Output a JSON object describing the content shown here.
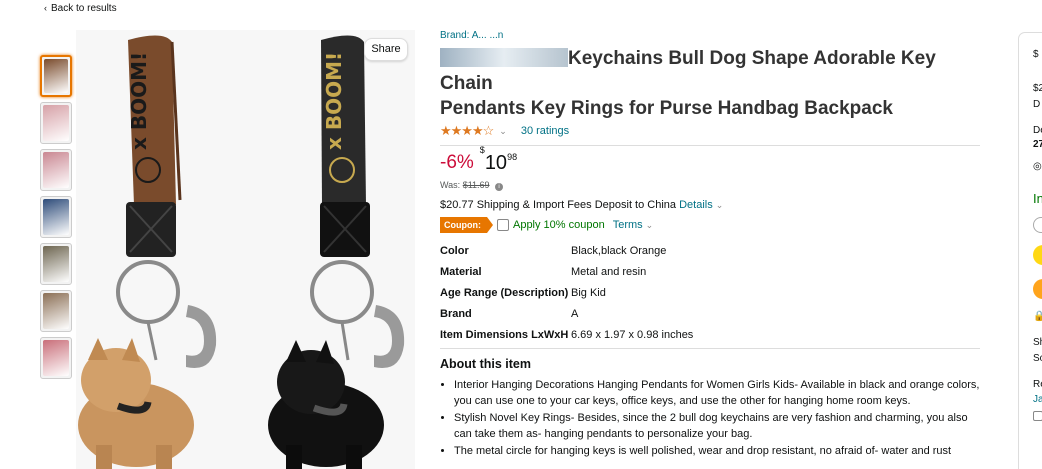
{
  "nav": {
    "back_label": "Back to results"
  },
  "gallery": {
    "share_label": "Share",
    "thumbnails": [
      "#7a4b2c",
      "#d6a1a7",
      "#c98792",
      "#2e4c7a",
      "#6d6550",
      "#8b6f55",
      "#c96f7a"
    ]
  },
  "product": {
    "brand_label": "Brand: A... ...n",
    "title_part1": "Keychains Bull Dog Shape Adorable Key Chain",
    "title_part2": "Pendants Key Rings for Purse Handbag Backpack",
    "stars": "★★★★☆",
    "ratings_count": "30 ratings",
    "discount": "-6%",
    "price_symbol": "$",
    "price_whole": "10",
    "price_cents": "98",
    "was_label": "Was:",
    "was_price": "$11.69",
    "shipping_text": "$20.77 Shipping & Import Fees Deposit to China",
    "shipping_details": "Details",
    "coupon_badge": "Coupon:",
    "coupon_text": "Apply 10% coupon",
    "terms_label": "Terms"
  },
  "specs": [
    {
      "key": "Color",
      "value": "Black,black Orange"
    },
    {
      "key": "Material",
      "value": "Metal and resin"
    },
    {
      "key": "Age Range (Description)",
      "value": "Big Kid"
    },
    {
      "key": "Brand",
      "value": "A"
    },
    {
      "key": "Item Dimensions LxWxH",
      "value": "6.69 x 1.97 x 0.98 inches"
    }
  ],
  "about": {
    "title": "About this item",
    "bullets": [
      "Interior Hanging Decorations Hanging Pendants for Women Girls Kids- Available in black and orange colors, you can use one to your car keys, office keys, and use the other for hanging home room keys.",
      "Stylish Novel Key Rings- Besides, since the 2 bull dog keychains are very fashion and charming, you also can take them as- hanging pendants to personalize your bag.",
      "The metal circle for hanging keys is well polished, wear and drop resistant, no afraid of- water and rust"
    ]
  },
  "buybox": {
    "price_partial": "$",
    "line_a": "$2",
    "line_b": "D",
    "line_c": "De",
    "line_d": "27",
    "in_stock_partial": "In",
    "ship_a": "Sh",
    "ship_b": "So",
    "ret_a": "Re",
    "ret_b": "Ja"
  },
  "colors": {
    "link": "#007185",
    "discount": "#cc0c39",
    "coupon": "#e77600",
    "star": "#de7921",
    "cart_button": "#ffd814",
    "buy_button": "#ffa41c"
  }
}
